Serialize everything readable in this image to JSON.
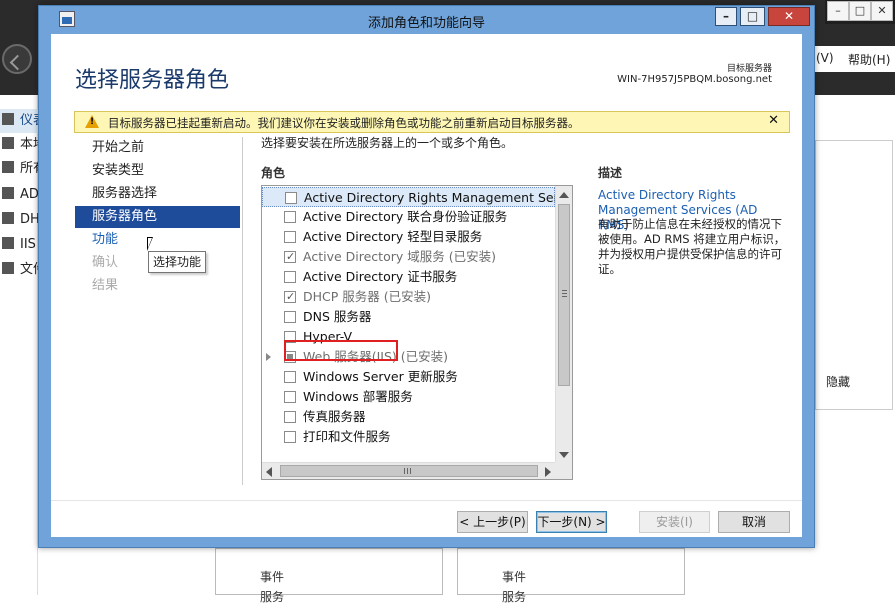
{
  "background": {
    "menu": [
      "(V)",
      "帮助(H)"
    ],
    "sidebar": [
      "仪表板",
      "本地服务器",
      "所有服务器",
      "AD DS",
      "DHCP",
      "IIS",
      "文件和存储服务"
    ],
    "hide_label": "隐藏",
    "bottom_labels": [
      "事件",
      "服务",
      "事件",
      "服务"
    ]
  },
  "wizard": {
    "title": "添加角色和功能向导",
    "page_title": "选择服务器角色",
    "target_label": "目标服务器",
    "target_value": "WIN-7H957J5PBQM.bosong.net",
    "warning": "目标服务器已挂起重新启动。我们建议你在安装或删除角色或功能之前重新启动目标服务器。",
    "nav": [
      {
        "label": "开始之前",
        "state": "done"
      },
      {
        "label": "安装类型",
        "state": "done"
      },
      {
        "label": "服务器选择",
        "state": "done"
      },
      {
        "label": "服务器角色",
        "state": "active"
      },
      {
        "label": "功能",
        "state": "link"
      },
      {
        "label": "确认",
        "state": "disabled"
      },
      {
        "label": "结果",
        "state": "disabled"
      }
    ],
    "tooltip": "选择功能",
    "instruction": "选择要安装在所选服务器上的一个或多个角色。",
    "roles_header": "角色",
    "description_header": "描述",
    "roles": [
      {
        "label": "Active Directory Rights Management Services",
        "checked": false,
        "installed": false,
        "selected": true
      },
      {
        "label": "Active Directory 联合身份验证服务",
        "checked": false,
        "installed": false
      },
      {
        "label": "Active Directory 轻型目录服务",
        "checked": false,
        "installed": false
      },
      {
        "label": "Active Directory 域服务 (已安装)",
        "checked": true,
        "installed": true
      },
      {
        "label": "Active Directory 证书服务",
        "checked": false,
        "installed": false
      },
      {
        "label": "DHCP 服务器 (已安装)",
        "checked": true,
        "installed": true
      },
      {
        "label": "DNS 服务器",
        "checked": false,
        "installed": false,
        "highlighted": true
      },
      {
        "label": "Hyper-V",
        "checked": false,
        "installed": false
      },
      {
        "label": "Web 服务器(IIS) (已安装)",
        "checked": "partial",
        "installed": true,
        "expandable": true
      },
      {
        "label": "Windows Server 更新服务",
        "checked": false,
        "installed": false
      },
      {
        "label": "Windows 部署服务",
        "checked": false,
        "installed": false
      },
      {
        "label": "传真服务器",
        "checked": false,
        "installed": false
      },
      {
        "label": "打印和文件服务",
        "checked": false,
        "installed": false
      }
    ],
    "description_title": "Active Directory Rights Management Services (AD RMS)",
    "description_body": "有助于防止信息在未经授权的情况下被使用。AD RMS 将建立用户标识，并为授权用户提供受保护信息的许可证。",
    "buttons": {
      "prev": "< 上一步(P)",
      "next": "下一步(N) >",
      "install": "安装(I)",
      "cancel": "取消"
    },
    "colors": {
      "accent": "#1e4b9a",
      "link": "#1b5fb3",
      "warning_bg": "#fdf6b4",
      "highlight": "#e02020"
    }
  }
}
